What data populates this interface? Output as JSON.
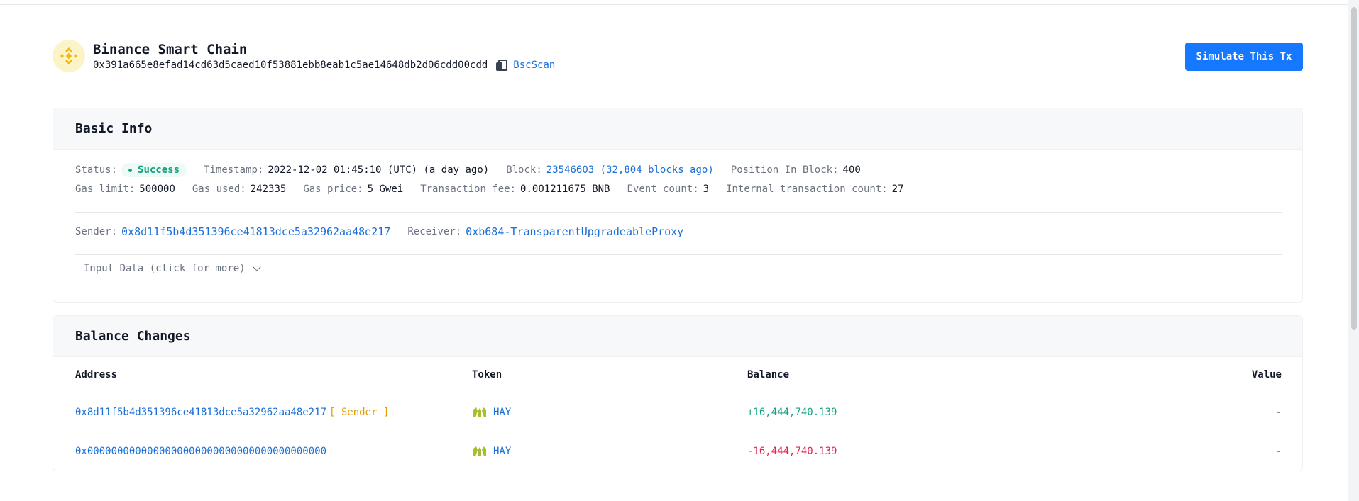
{
  "header": {
    "chain_name": "Binance Smart Chain",
    "tx_hash": "0x391a665e8efad14cd63d5caed10f53881ebb8eab1c5ae14648db2d06cdd00cdd",
    "explorer_link": "BscScan",
    "simulate_label": "Simulate This Tx"
  },
  "basic_info": {
    "title": "Basic Info",
    "status_label": "Status:",
    "status_value": "Success",
    "timestamp_label": "Timestamp:",
    "timestamp_value": "2022-12-02 01:45:10 (UTC) (a day ago)",
    "block_label": "Block:",
    "block_value": "23546603 (32,804 blocks ago)",
    "position_label": "Position In Block:",
    "position_value": "400",
    "gas_limit_label": "Gas limit:",
    "gas_limit_value": "500000",
    "gas_used_label": "Gas used:",
    "gas_used_value": "242335",
    "gas_price_label": "Gas price:",
    "gas_price_value": "5 Gwei",
    "fee_label": "Transaction fee:",
    "fee_value": "0.001211675 BNB",
    "event_count_label": "Event count:",
    "event_count_value": "3",
    "internal_count_label": "Internal transaction count:",
    "internal_count_value": "27",
    "sender_label": "Sender:",
    "sender_value": "0x8d11f5b4d351396ce41813dce5a32962aa48e217",
    "receiver_label": "Receiver:",
    "receiver_value": "0xb684-TransparentUpgradeableProxy",
    "input_data_label": "Input Data (click for more)"
  },
  "balance_changes": {
    "title": "Balance Changes",
    "columns": [
      "Address",
      "Token",
      "Balance",
      "Value"
    ],
    "rows": [
      {
        "address": "0x8d11f5b4d351396ce41813dce5a32962aa48e217",
        "tag": "[ Sender ]",
        "token": "HAY",
        "balance": "+16,444,740.139",
        "value": "-"
      },
      {
        "address": "0x0000000000000000000000000000000000000000",
        "tag": "",
        "token": "HAY",
        "balance": "-16,444,740.139",
        "value": "-"
      }
    ]
  },
  "colors": {
    "accent": "#1677ff",
    "link": "#1a6fd8",
    "success": "#14a37f",
    "negative": "#e02450",
    "sender_tag": "#e69b00",
    "bnb_gold": "#f0b90b"
  },
  "icons": [
    "bnb-logo-icon",
    "copy-icon",
    "chevron-down-icon",
    "hay-token-icon"
  ]
}
